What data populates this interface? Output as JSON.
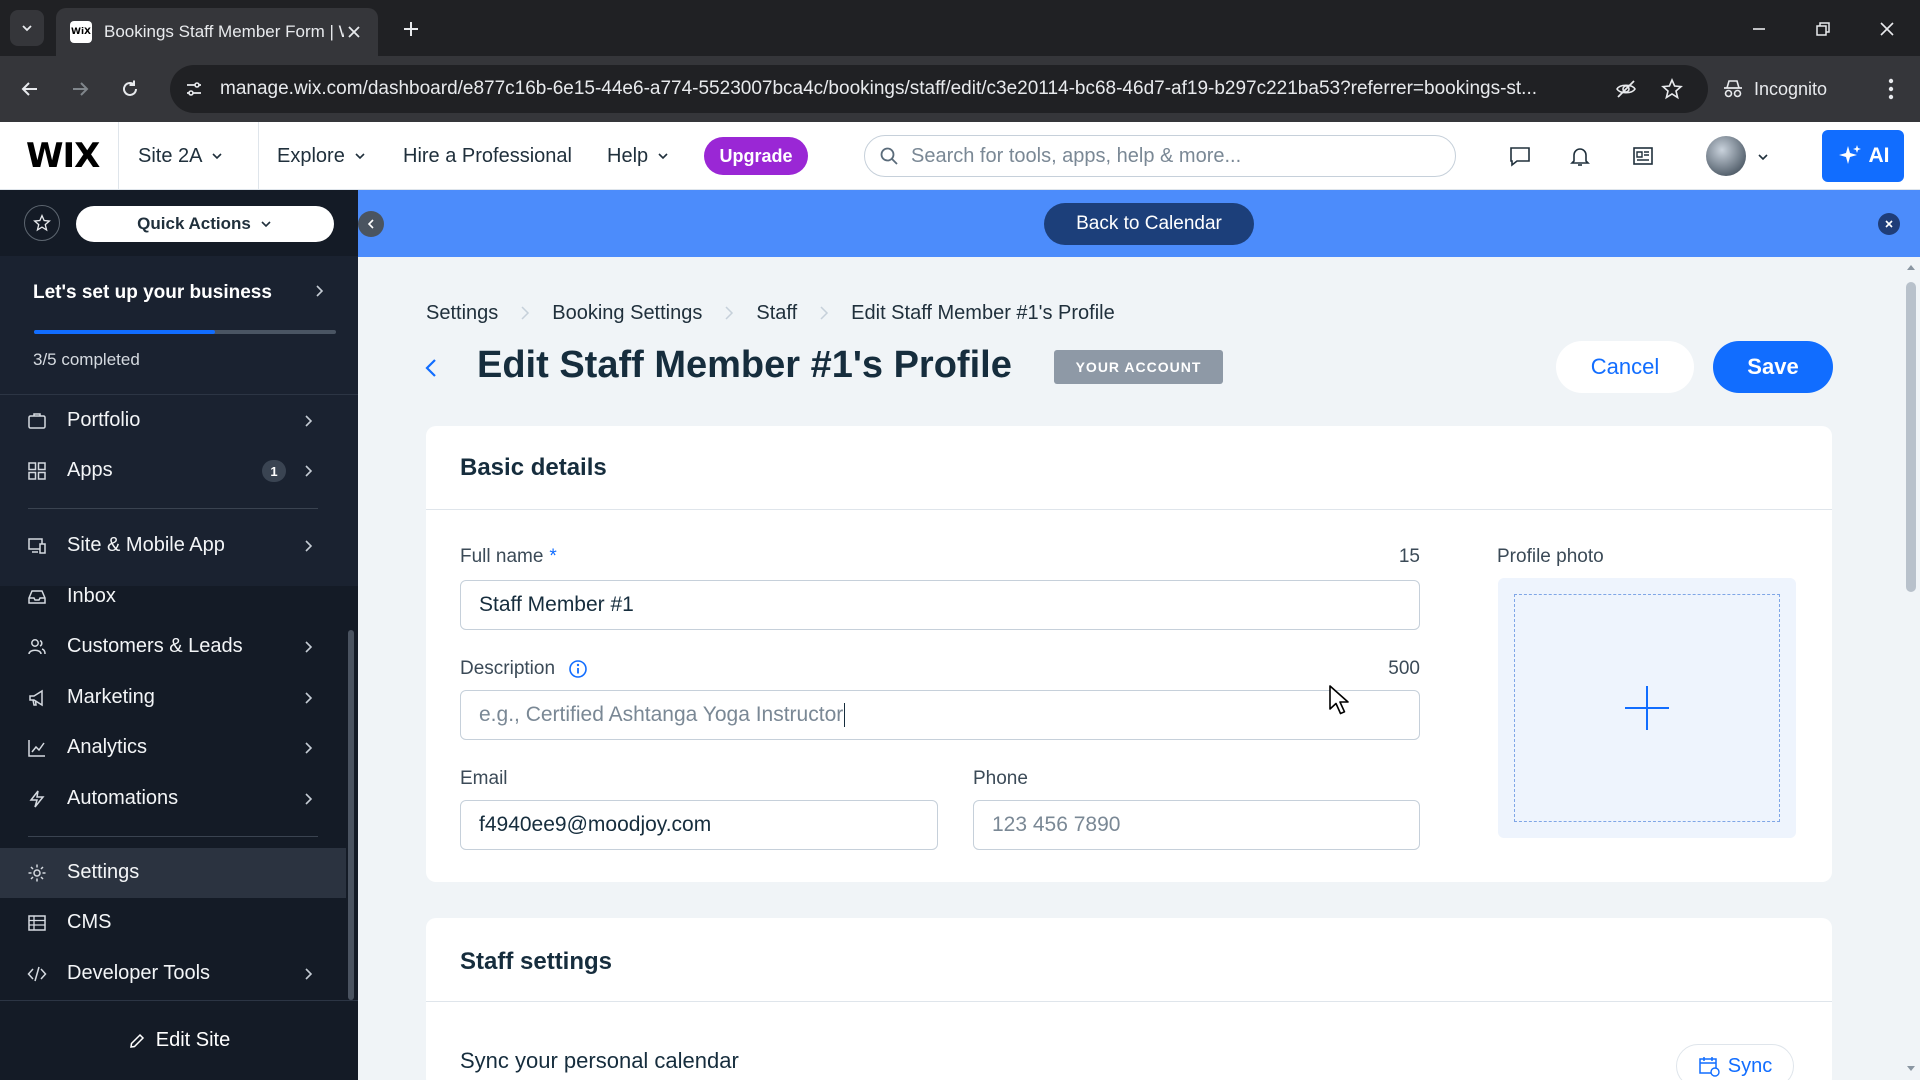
{
  "browser": {
    "tab_title": "Bookings Staff Member Form | Wix",
    "favicon_text": "WiX",
    "url": "manage.wix.com/dashboard/e877c16b-6e15-44e6-a774-5523007bca4c/bookings/staff/edit/c3e20114-bc68-46d7-af19-b297c221ba53?referrer=bookings-st...",
    "incognito_label": "Incognito"
  },
  "topbar": {
    "logo": "WIX",
    "site_name": "Site 2A",
    "explore": "Explore",
    "hire": "Hire a Professional",
    "help": "Help",
    "upgrade": "Upgrade",
    "search_placeholder": "Search for tools, apps, help & more...",
    "ai_label": "AI"
  },
  "sidebar": {
    "quick_actions": "Quick Actions",
    "setup_title": "Let's set up your business",
    "setup_progress": 0.6,
    "setup_count": "3/5 completed",
    "items": [
      {
        "label": "Portfolio"
      },
      {
        "label": "Apps",
        "badge": "1"
      },
      {
        "label": "Site & Mobile App"
      },
      {
        "label": "Inbox"
      },
      {
        "label": "Customers & Leads"
      },
      {
        "label": "Marketing"
      },
      {
        "label": "Analytics"
      },
      {
        "label": "Automations"
      },
      {
        "label": "Settings"
      },
      {
        "label": "CMS"
      },
      {
        "label": "Developer Tools"
      }
    ],
    "active_item": "Settings",
    "edit_site": "Edit Site"
  },
  "banner": {
    "back_to_calendar": "Back to Calendar"
  },
  "breadcrumb": [
    "Settings",
    "Booking Settings",
    "Staff",
    "Edit Staff Member #1's Profile"
  ],
  "page": {
    "title": "Edit Staff Member #1's Profile",
    "badge": "YOUR ACCOUNT",
    "cancel": "Cancel",
    "save": "Save"
  },
  "basic_details": {
    "title": "Basic details",
    "full_name_label": "Full name",
    "full_name_required": "*",
    "full_name_counter": "15",
    "full_name_value": "Staff Member #1",
    "description_label": "Description",
    "description_counter": "500",
    "description_placeholder": "e.g., Certified Ashtanga Yoga Instructor",
    "email_label": "Email",
    "email_value": "f4940ee9@moodjoy.com",
    "phone_label": "Phone",
    "phone_placeholder": "123 456 7890",
    "profile_photo_label": "Profile photo"
  },
  "staff_settings": {
    "title": "Staff settings",
    "sync_title": "Sync your personal calendar",
    "sync_button": "Sync"
  },
  "colors": {
    "accent": "#116dff",
    "upgrade": "#9a27d5",
    "sidebar_bg": "#141b26",
    "banner": "#4c8cfb"
  }
}
